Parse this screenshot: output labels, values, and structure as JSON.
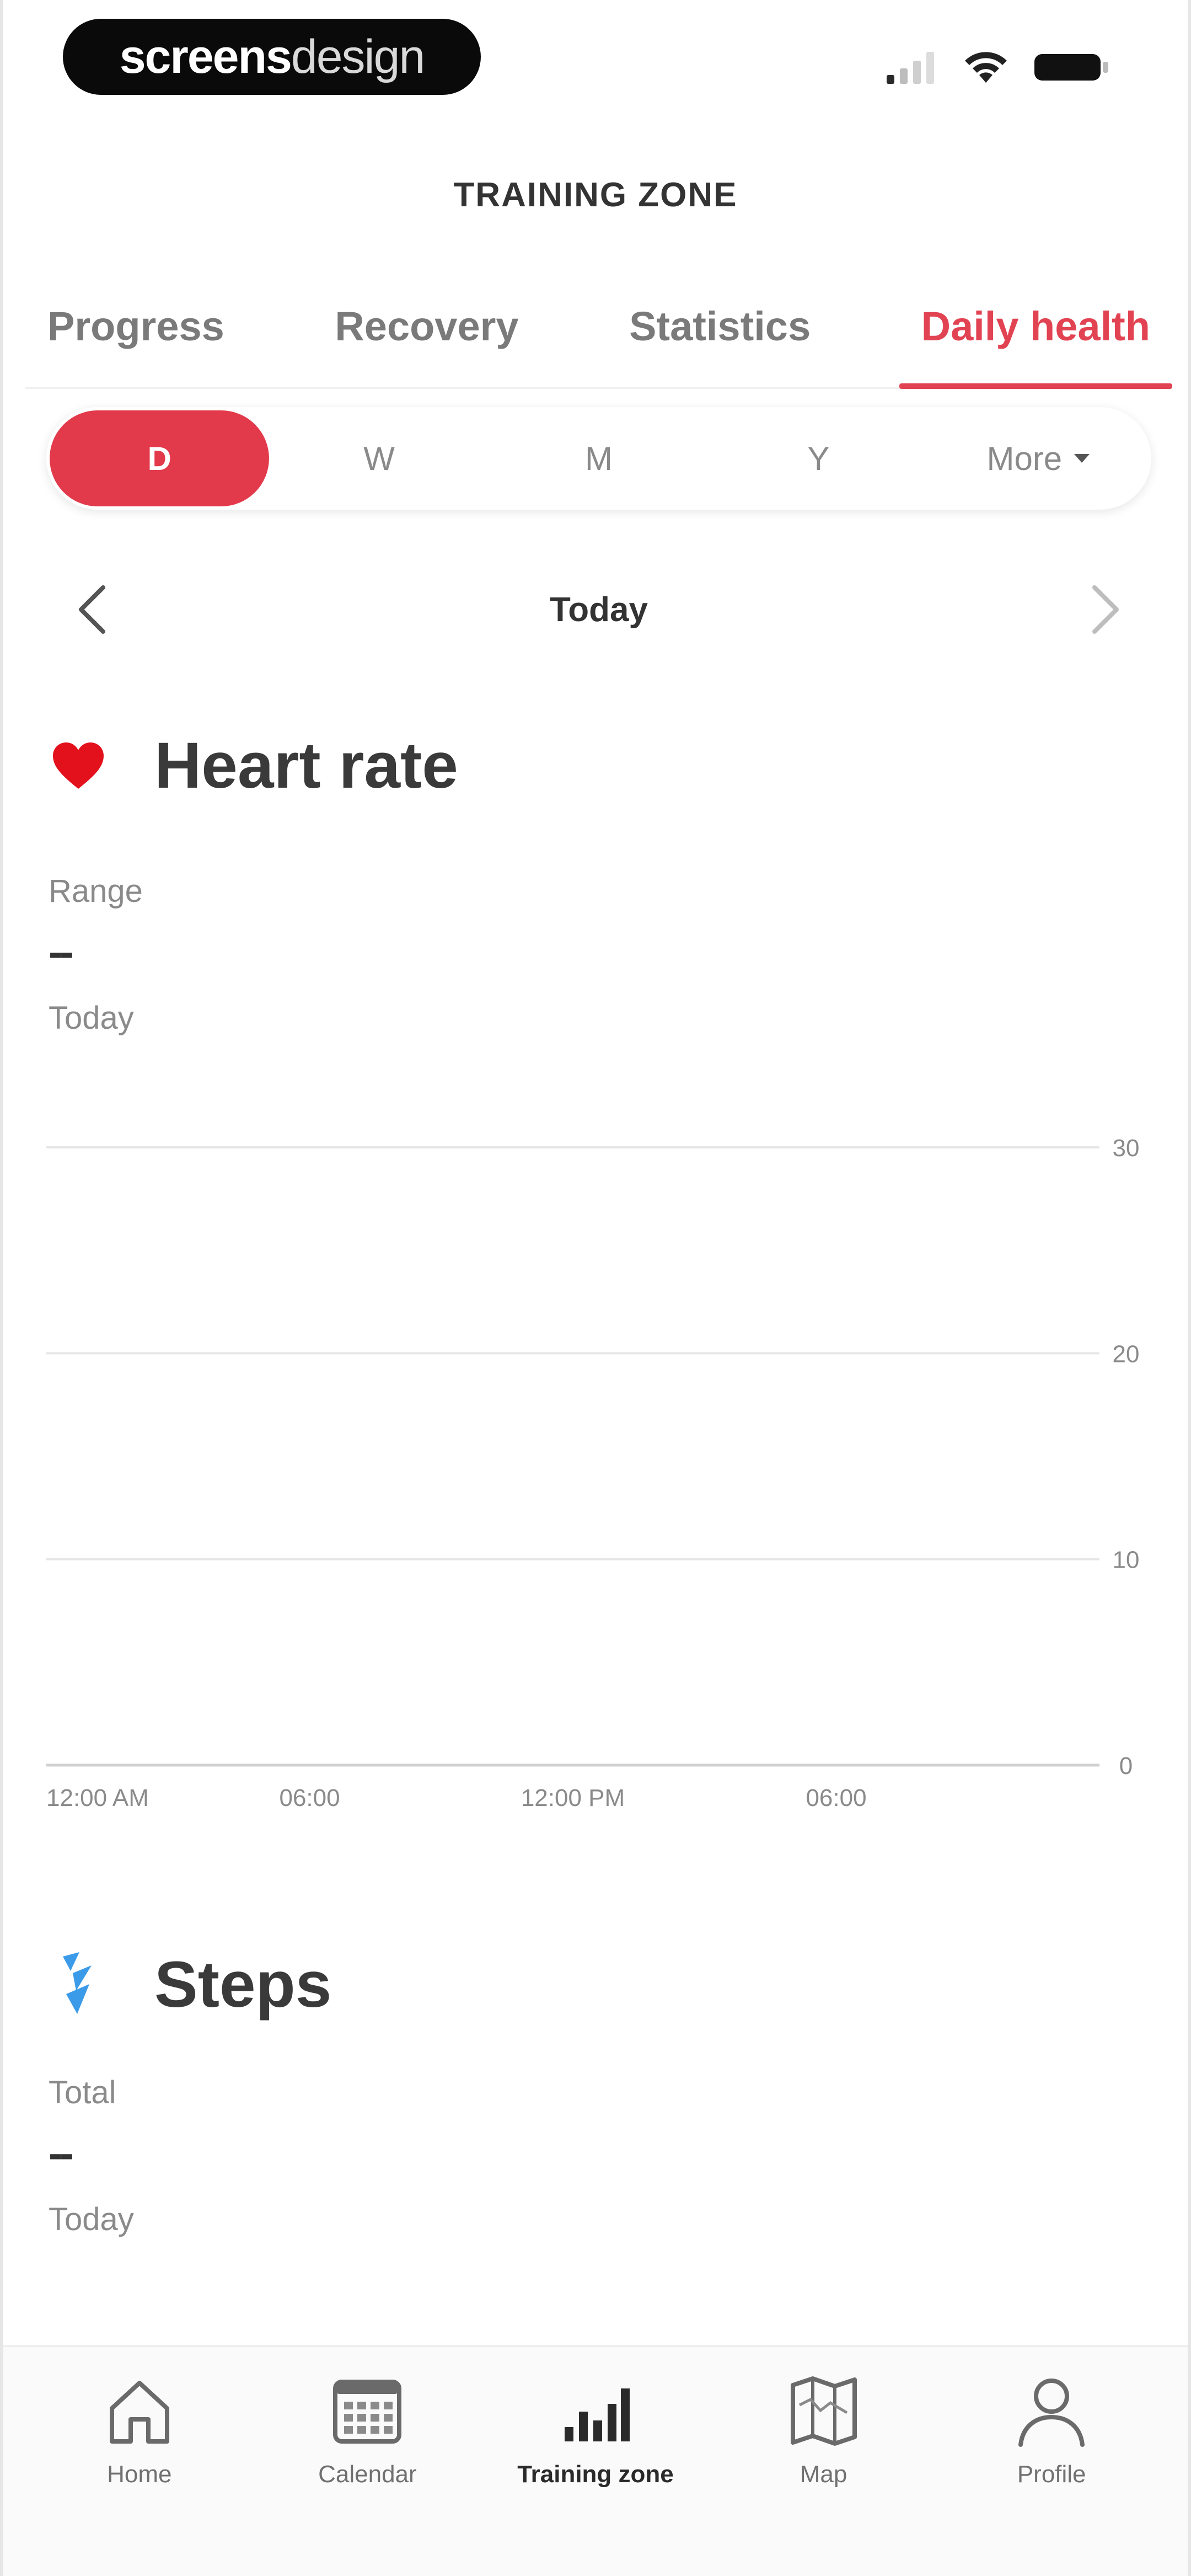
{
  "status_bar": {
    "logo_bold": "screens",
    "logo_light": "design",
    "icons": [
      "signal-icon",
      "wifi-icon",
      "battery-icon"
    ]
  },
  "header": {
    "title": "TRAINING ZONE"
  },
  "tabs": [
    {
      "label": "Progress",
      "active": false
    },
    {
      "label": "Recovery",
      "active": false
    },
    {
      "label": "Statistics",
      "active": false
    },
    {
      "label": "Daily health",
      "active": true
    }
  ],
  "period": {
    "options": [
      "D",
      "W",
      "M",
      "Y"
    ],
    "more_label": "More",
    "selected": "D"
  },
  "date_nav": {
    "label": "Today"
  },
  "heart_rate": {
    "title": "Heart rate",
    "icon": "heart-icon",
    "stat_label": "Range",
    "stat_value": "--",
    "stat_period": "Today"
  },
  "steps": {
    "title": "Steps",
    "icon": "steps-icon",
    "stat_label": "Total",
    "stat_value": "--",
    "stat_period": "Today"
  },
  "chart_data": {
    "type": "line",
    "x_tick_labels": [
      "12:00 AM",
      "06:00",
      "12:00 PM",
      "06:00"
    ],
    "y_ticks": [
      0,
      10,
      20,
      30
    ],
    "ylim": [
      0,
      30
    ],
    "series": [],
    "grid": true
  },
  "bottom_nav": [
    {
      "label": "Home",
      "icon": "home-icon",
      "active": false
    },
    {
      "label": "Calendar",
      "icon": "calendar-icon",
      "active": false
    },
    {
      "label": "Training zone",
      "icon": "bar-chart-icon",
      "active": true
    },
    {
      "label": "Map",
      "icon": "map-icon",
      "active": false
    },
    {
      "label": "Profile",
      "icon": "profile-icon",
      "active": false
    }
  ],
  "colors": {
    "accent": "#e23a4b",
    "heart": "#e3111c",
    "steps": "#3b9be8"
  }
}
